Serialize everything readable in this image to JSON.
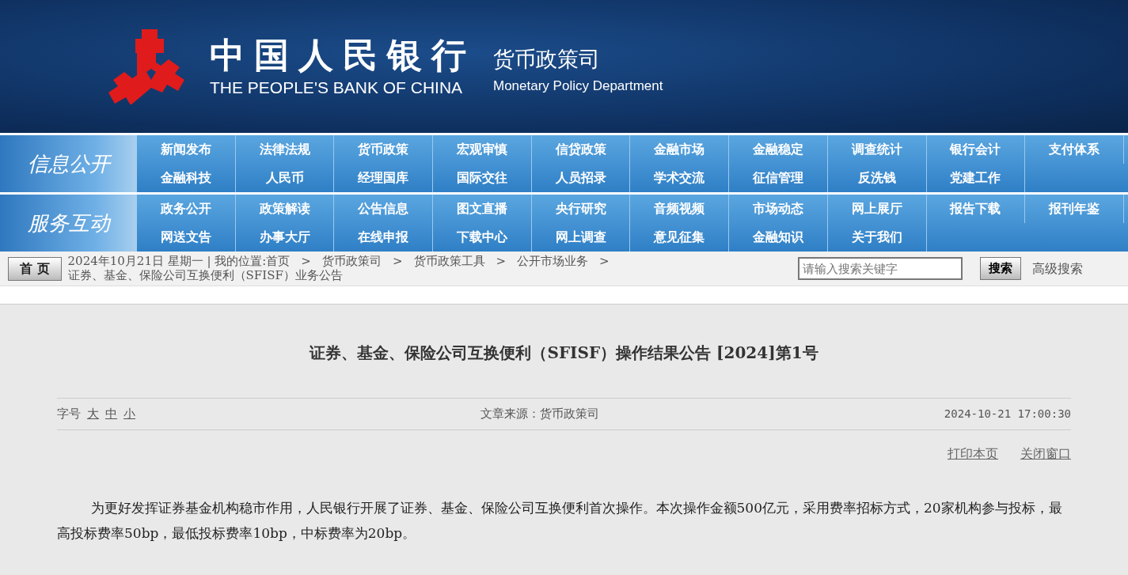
{
  "header": {
    "logo_cn": "中国人民银行",
    "logo_en": "THE PEOPLE'S BANK OF CHINA",
    "dept_cn": "货币政策司",
    "dept_en": "Monetary Policy Department"
  },
  "nav_sections": [
    {
      "label": "信息公开",
      "items": [
        "新闻发布",
        "法律法规",
        "货币政策",
        "宏观审慎",
        "信贷政策",
        "金融市场",
        "金融稳定",
        "调查统计",
        "银行会计",
        "支付体系",
        "金融科技",
        "人民币",
        "经理国库",
        "国际交往",
        "人员招录",
        "学术交流",
        "征信管理",
        "反洗钱",
        "党建工作"
      ]
    },
    {
      "label": "服务互动",
      "items": [
        "政务公开",
        "政策解读",
        "公告信息",
        "图文直播",
        "央行研究",
        "音频视频",
        "市场动态",
        "网上展厅",
        "报告下载",
        "报刊年鉴",
        "网送文告",
        "办事大厅",
        "在线申报",
        "下载中心",
        "网上调查",
        "意见征集",
        "金融知识",
        "关于我们"
      ]
    }
  ],
  "toolbar": {
    "home_button": "首 页",
    "date": "2024年10月21日 星期一 | 我的位置:",
    "breadcrumbs": [
      "首页",
      "货币政策司",
      "货币政策工具",
      "公开市场业务",
      "证券、基金、保险公司互换便利（SFISF）业务公告"
    ],
    "separator": ">",
    "search": {
      "placeholder": "请输入搜索关键字"
    },
    "search_button": "搜索",
    "advanced_search": "高级搜索"
  },
  "article": {
    "title": "证券、基金、保险公司互换便利（SFISF）操作结果公告 [2024]第1号",
    "font_size_label": "字号",
    "font_sizes": [
      "大",
      "中",
      "小"
    ],
    "source": "文章来源：货币政策司",
    "datetime": "2024-10-21 17:00:30",
    "actions": [
      "打印本页",
      "关闭窗口"
    ],
    "paragraphs": [
      "为更好发挥证券基金机构稳市作用，人民银行开展了证券、基金、保险公司互换便利首次操作。本次操作金额500亿元，采用费率招标方式，20家机构参与投标，最高投标费率50bp，最低投标费率10bp，中标费率为20bp。"
    ]
  }
}
